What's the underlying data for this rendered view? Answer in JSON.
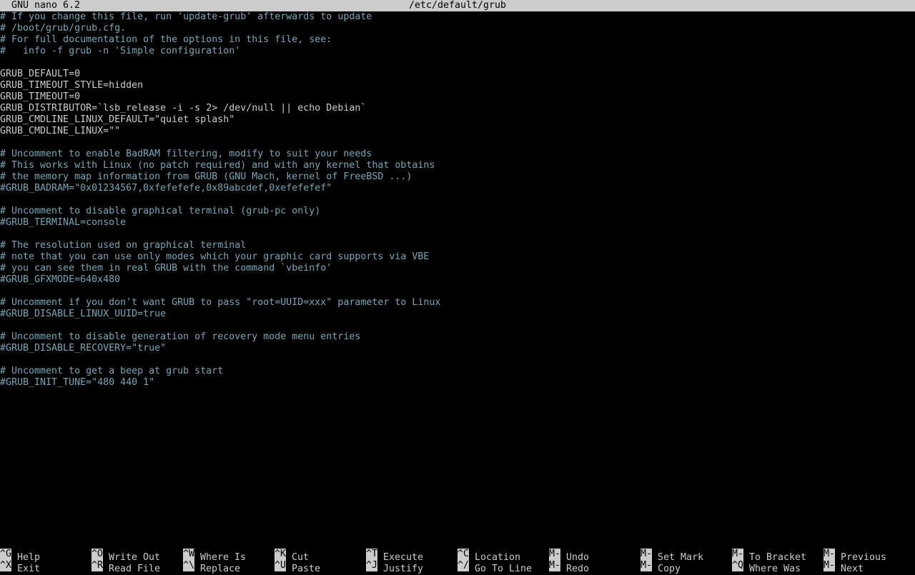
{
  "window": {
    "app_title": "GNU nano 6.2",
    "file_path": "/etc/default/grub"
  },
  "colors": {
    "background": "#000000",
    "text": "#cccccc",
    "comment": "#6fa9b8",
    "title_bar": "#cccccc"
  },
  "editor": {
    "lines": [
      {
        "text": "# If you change this file, run 'update-grub' afterwards to update",
        "kind": "comment"
      },
      {
        "text": "# /boot/grub/grub.cfg.",
        "kind": "comment"
      },
      {
        "text": "# For full documentation of the options in this file, see:",
        "kind": "comment"
      },
      {
        "text": "#   info -f grub -n 'Simple configuration'",
        "kind": "comment"
      },
      {
        "text": "",
        "kind": "code"
      },
      {
        "text": "GRUB_DEFAULT=0",
        "kind": "code"
      },
      {
        "text": "GRUB_TIMEOUT_STYLE=hidden",
        "kind": "code"
      },
      {
        "text": "GRUB_TIMEOUT=0",
        "kind": "code"
      },
      {
        "text": "GRUB_DISTRIBUTOR=`lsb_release -i -s 2> /dev/null || echo Debian`",
        "kind": "code"
      },
      {
        "text": "GRUB_CMDLINE_LINUX_DEFAULT=\"quiet splash\"",
        "kind": "code"
      },
      {
        "text": "GRUB_CMDLINE_LINUX=\"\"",
        "kind": "code"
      },
      {
        "text": "",
        "kind": "code"
      },
      {
        "text": "# Uncomment to enable BadRAM filtering, modify to suit your needs",
        "kind": "comment"
      },
      {
        "text": "# This works with Linux (no patch required) and with any kernel that obtains",
        "kind": "comment"
      },
      {
        "text": "# the memory map information from GRUB (GNU Mach, kernel of FreeBSD ...)",
        "kind": "comment"
      },
      {
        "text": "#GRUB_BADRAM=\"0x01234567,0xfefefefe,0x89abcdef,0xefefefef\"",
        "kind": "comment"
      },
      {
        "text": "",
        "kind": "code"
      },
      {
        "text": "# Uncomment to disable graphical terminal (grub-pc only)",
        "kind": "comment"
      },
      {
        "text": "#GRUB_TERMINAL=console",
        "kind": "comment"
      },
      {
        "text": "",
        "kind": "code"
      },
      {
        "text": "# The resolution used on graphical terminal",
        "kind": "comment"
      },
      {
        "text": "# note that you can use only modes which your graphic card supports via VBE",
        "kind": "comment"
      },
      {
        "text": "# you can see them in real GRUB with the command `vbeinfo'",
        "kind": "comment"
      },
      {
        "text": "#GRUB_GFXMODE=640x480",
        "kind": "comment"
      },
      {
        "text": "",
        "kind": "code"
      },
      {
        "text": "# Uncomment if you don't want GRUB to pass \"root=UUID=xxx\" parameter to Linux",
        "kind": "comment"
      },
      {
        "text": "#GRUB_DISABLE_LINUX_UUID=true",
        "kind": "comment"
      },
      {
        "text": "",
        "kind": "code"
      },
      {
        "text": "# Uncomment to disable generation of recovery mode menu entries",
        "kind": "comment"
      },
      {
        "text": "#GRUB_DISABLE_RECOVERY=\"true\"",
        "kind": "comment"
      },
      {
        "text": "",
        "kind": "code"
      },
      {
        "text": "# Uncomment to get a beep at grub start",
        "kind": "comment"
      },
      {
        "text": "#GRUB_INIT_TUNE=\"480 440 1\"",
        "kind": "comment"
      }
    ]
  },
  "shortcuts": {
    "row1": [
      {
        "key": "^G",
        "label": "Help",
        "name": "help"
      },
      {
        "key": "^O",
        "label": "Write Out",
        "name": "write-out"
      },
      {
        "key": "^W",
        "label": "Where Is",
        "name": "where-is"
      },
      {
        "key": "^K",
        "label": "Cut",
        "name": "cut"
      },
      {
        "key": "^T",
        "label": "Execute",
        "name": "execute"
      },
      {
        "key": "^C",
        "label": "Location",
        "name": "location"
      },
      {
        "key": "M-U",
        "label": "Undo",
        "name": "undo"
      },
      {
        "key": "M-A",
        "label": "Set Mark",
        "name": "set-mark"
      },
      {
        "key": "M-]",
        "label": "To Bracket",
        "name": "to-bracket"
      },
      {
        "key": "M-Q",
        "label": "Previous",
        "name": "previous"
      }
    ],
    "row2": [
      {
        "key": "^X",
        "label": "Exit",
        "name": "exit"
      },
      {
        "key": "^R",
        "label": "Read File",
        "name": "read-file"
      },
      {
        "key": "^\\",
        "label": "Replace",
        "name": "replace"
      },
      {
        "key": "^U",
        "label": "Paste",
        "name": "paste"
      },
      {
        "key": "^J",
        "label": "Justify",
        "name": "justify"
      },
      {
        "key": "^/",
        "label": "Go To Line",
        "name": "go-to-line"
      },
      {
        "key": "M-E",
        "label": "Redo",
        "name": "redo"
      },
      {
        "key": "M-6",
        "label": "Copy",
        "name": "copy"
      },
      {
        "key": "^Q",
        "label": "Where Was",
        "name": "where-was"
      },
      {
        "key": "M-W",
        "label": "Next",
        "name": "next"
      }
    ]
  }
}
